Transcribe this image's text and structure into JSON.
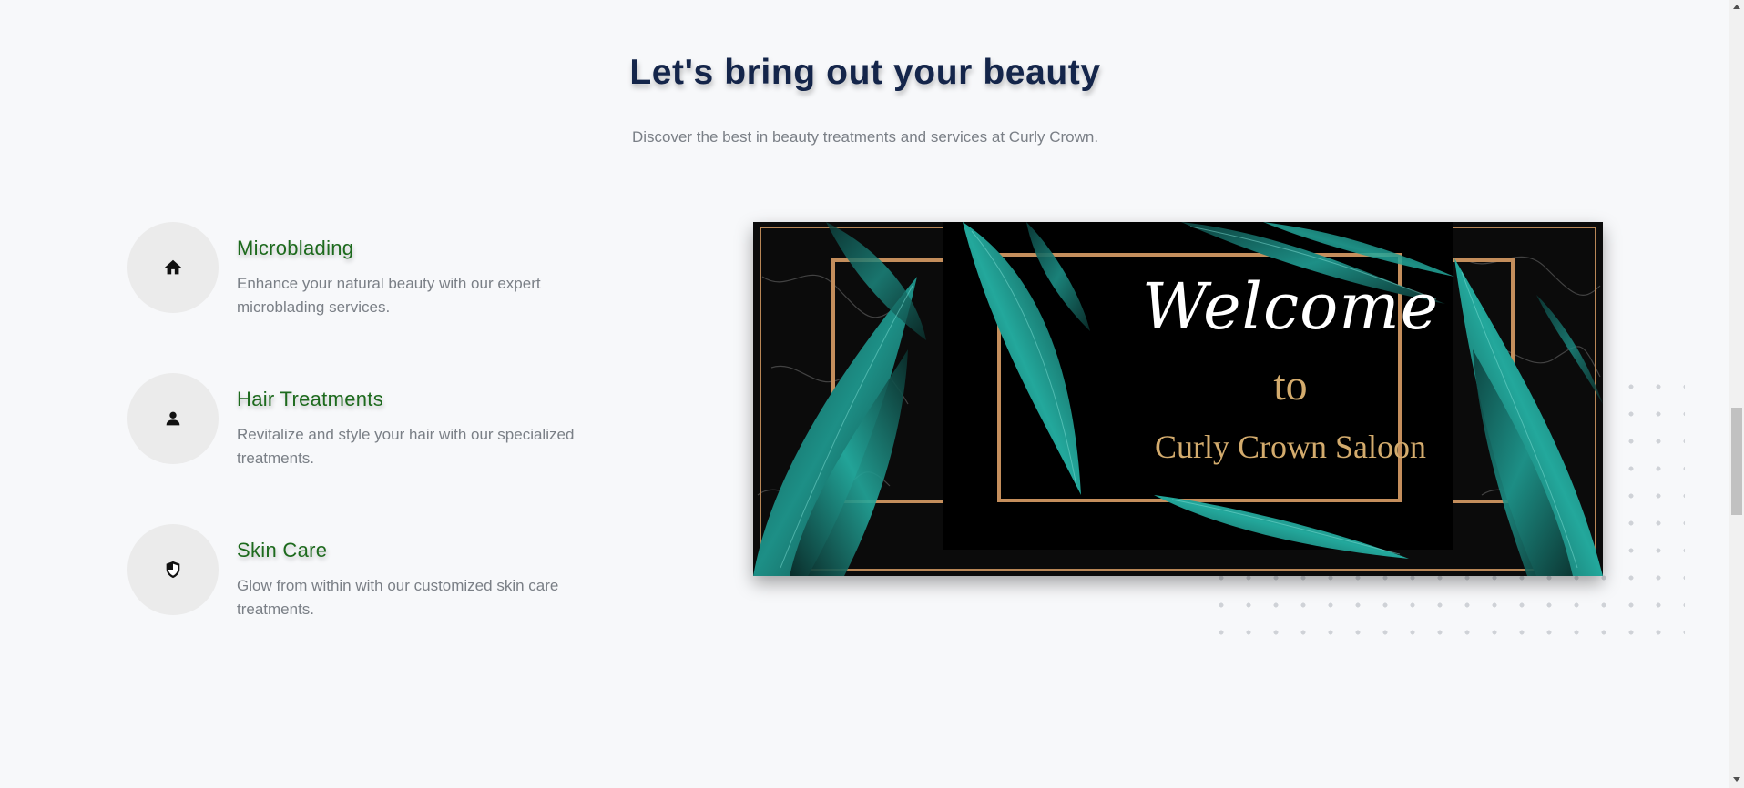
{
  "header": {
    "title": "Let's bring out your beauty",
    "subtitle": "Discover the best in beauty treatments and services at Curly Crown."
  },
  "features": [
    {
      "icon": "home-icon",
      "title": "Microblading",
      "description": "Enhance your natural beauty with our expert microblading services."
    },
    {
      "icon": "person-icon",
      "title": "Hair Treatments",
      "description": "Revitalize and style your hair with our specialized treatments."
    },
    {
      "icon": "shield-icon",
      "title": "Skin Care",
      "description": "Glow from within with our customized skin care treatments."
    }
  ],
  "banner": {
    "line1": "Welcome",
    "line2": "to",
    "line3": "Curly Crown Saloon"
  },
  "colors": {
    "background": "#f7f8fa",
    "heading": "#14254a",
    "feature_title": "#1d6a1d",
    "body_text": "#7a7f86",
    "banner_gold": "#d3ab6d",
    "banner_leaf": "#1d8f86"
  }
}
